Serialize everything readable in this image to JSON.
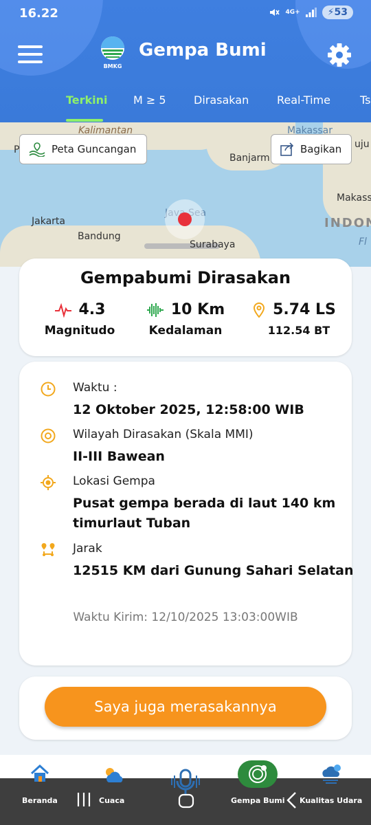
{
  "status_bar": {
    "time": "16.22",
    "network": "4G+",
    "battery": "53"
  },
  "header": {
    "title": "Gempa Bumi",
    "logo_text": "BMKG"
  },
  "tabs": [
    {
      "label": "Terkini",
      "active": true
    },
    {
      "label": "M ≥ 5",
      "active": false
    },
    {
      "label": "Dirasakan",
      "active": false
    },
    {
      "label": "Real-Time",
      "active": false
    },
    {
      "label": "Ts",
      "active": false
    }
  ],
  "map": {
    "shake_map_button": "Peta Guncangan",
    "share_button": "Bagikan",
    "labels": {
      "kalimantan": "Kalimantan",
      "makassar_strait": "Makassar",
      "banjarmasin": "Banjarm",
      "java_sea": "Java Sea",
      "jakarta": "Jakarta",
      "bandung": "Bandung",
      "surabaya": "Surabaya",
      "indonesia": "INDON",
      "makassar": "Makass",
      "flores": "Fl",
      "ujung": "uju",
      "left_p": "P"
    }
  },
  "summary": {
    "title": "Gempabumi Dirasakan",
    "magnitude": {
      "value": "4.3",
      "label": "Magnitudo"
    },
    "depth": {
      "value": "10 Km",
      "label": "Kedalaman"
    },
    "location": {
      "lat": "5.74 LS",
      "lon": "112.54 BT"
    }
  },
  "details": {
    "time_label": "Waktu :",
    "time_value": "12 Oktober 2025, 12:58:00 WIB",
    "region_label": "Wilayah Dirasakan (Skala MMI)",
    "region_value": "II-III Bawean",
    "location_label": "Lokasi Gempa",
    "location_value": "Pusat gempa berada di laut 140 km timurlaut Tuban",
    "distance_label": "Jarak",
    "distance_value": "12515 KM dari Gunung Sahari Selatan",
    "send_time": "Waktu Kirim: 12/10/2025 13:03:00WIB"
  },
  "cta_label": "Saya juga merasakannya",
  "bottom_nav": [
    {
      "label": "Beranda",
      "icon": "home-icon"
    },
    {
      "label": "Cuaca",
      "icon": "weather-icon"
    },
    {
      "label": "",
      "icon": "microphone-icon"
    },
    {
      "label": "Gempa Bumi",
      "icon": "earthquake-icon",
      "active": true
    },
    {
      "label": "Kualitas Udara",
      "icon": "air-quality-icon"
    }
  ],
  "colors": {
    "primary": "#3f7fe0",
    "active_tab": "#8ff06a",
    "accent": "#f7941d",
    "quake": "#e8313a",
    "icon_gold": "#f2a81d"
  }
}
